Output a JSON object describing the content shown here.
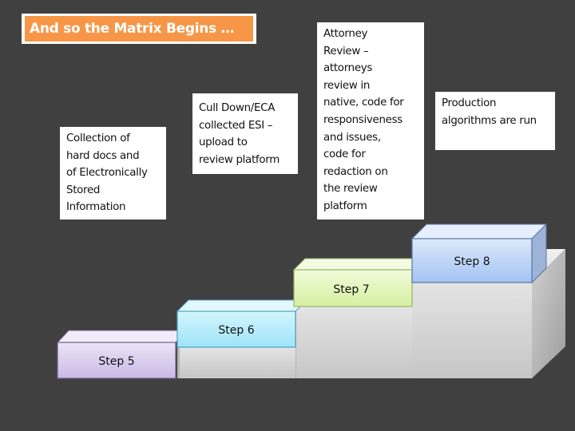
{
  "title": "And so the Matrix Begins …",
  "descriptions": [
    {
      "id": "collection",
      "text": "Collection of\nhard docs and\nof Electronically\nStored\nInformation"
    },
    {
      "id": "cull",
      "text": "Cull Down/ECA\ncollected ESI –\nupload to\nreview platform"
    },
    {
      "id": "attorney",
      "text": "Attorney\nReview –\nattorneys\nreview in\nnative, code for\nresponsiveness\nand issues,\ncode for\nredaction on\nthe review\nplatform"
    },
    {
      "id": "production",
      "text": "Production\nalgorithms are run"
    }
  ],
  "steps": [
    {
      "label": "Step 5",
      "color": "#ccc0e6"
    },
    {
      "label": "Step 6",
      "color": "#a7e6f8"
    },
    {
      "label": "Step 7",
      "color": "#d8f2a4"
    },
    {
      "label": "Step 8",
      "color": "#aac8f5"
    }
  ],
  "colors": {
    "background": "#404040",
    "title_fill": "#f79646",
    "title_text": "#ffffff",
    "pedestal": "#d6d6d6"
  }
}
